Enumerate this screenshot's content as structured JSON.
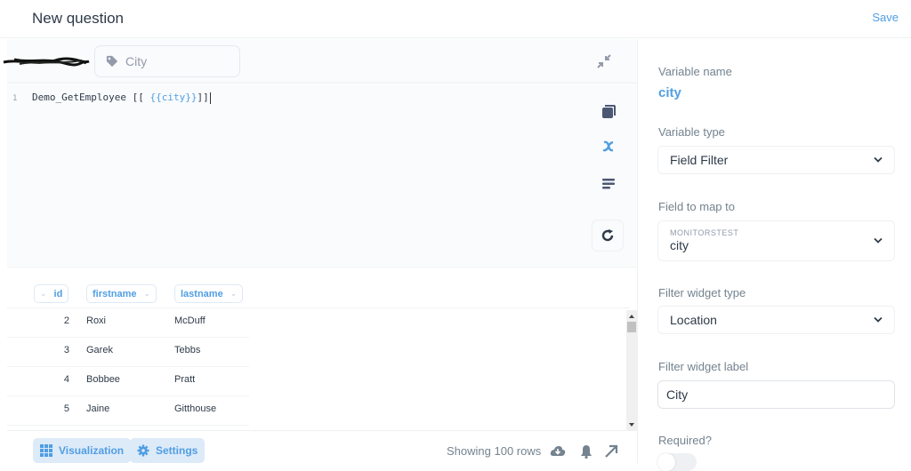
{
  "header": {
    "title": "New question",
    "save_label": "Save"
  },
  "toolbar": {
    "redacted_text": "",
    "parameter_chip_label": "City",
    "parameter_chip_icon": "tag-icon",
    "collapse_icon": "collapse-arrows-icon"
  },
  "editor": {
    "line_numbers": [
      "1"
    ],
    "code_prefix": "Demo_GetEmployee ",
    "code_open": "[[ ",
    "code_variable": "{{city}}",
    "code_close": "]]",
    "side_icons": [
      "data-reference-icon",
      "variables-icon",
      "snippets-icon",
      "run-refresh-icon"
    ]
  },
  "table": {
    "columns": [
      {
        "label": "id",
        "chevron": "⌄"
      },
      {
        "label": "firstname",
        "chevron": "⌄"
      },
      {
        "label": "lastname",
        "chevron": "⌄"
      }
    ],
    "rows": [
      {
        "id": "2",
        "firstname": "Roxi",
        "lastname": "McDuff"
      },
      {
        "id": "3",
        "firstname": "Garek",
        "lastname": "Tebbs"
      },
      {
        "id": "4",
        "firstname": "Bobbee",
        "lastname": "Pratt"
      },
      {
        "id": "5",
        "firstname": "Jaine",
        "lastname": "Gitthouse"
      }
    ]
  },
  "footer": {
    "visualization_label": "Visualization",
    "settings_label": "Settings",
    "rows_count": "Showing 100 rows",
    "icons": [
      "download-icon",
      "bell-icon",
      "expand-arrow-icon"
    ]
  },
  "sidebar": {
    "variable_name_label": "Variable name",
    "variable_name_value": "city",
    "variable_type_label": "Variable type",
    "variable_type_value": "Field Filter",
    "field_map_label": "Field to map to",
    "field_map_table": "MONITORSTEST",
    "field_map_value": "city",
    "widget_type_label": "Filter widget type",
    "widget_type_value": "Location",
    "widget_label_label": "Filter widget label",
    "widget_label_value": "City",
    "required_label": "Required?",
    "required_value": false
  },
  "colors": {
    "accent": "#509ee3",
    "text_dark": "#2e3a48",
    "text_muted": "#74838f",
    "button_bg": "#ddeaf8"
  }
}
